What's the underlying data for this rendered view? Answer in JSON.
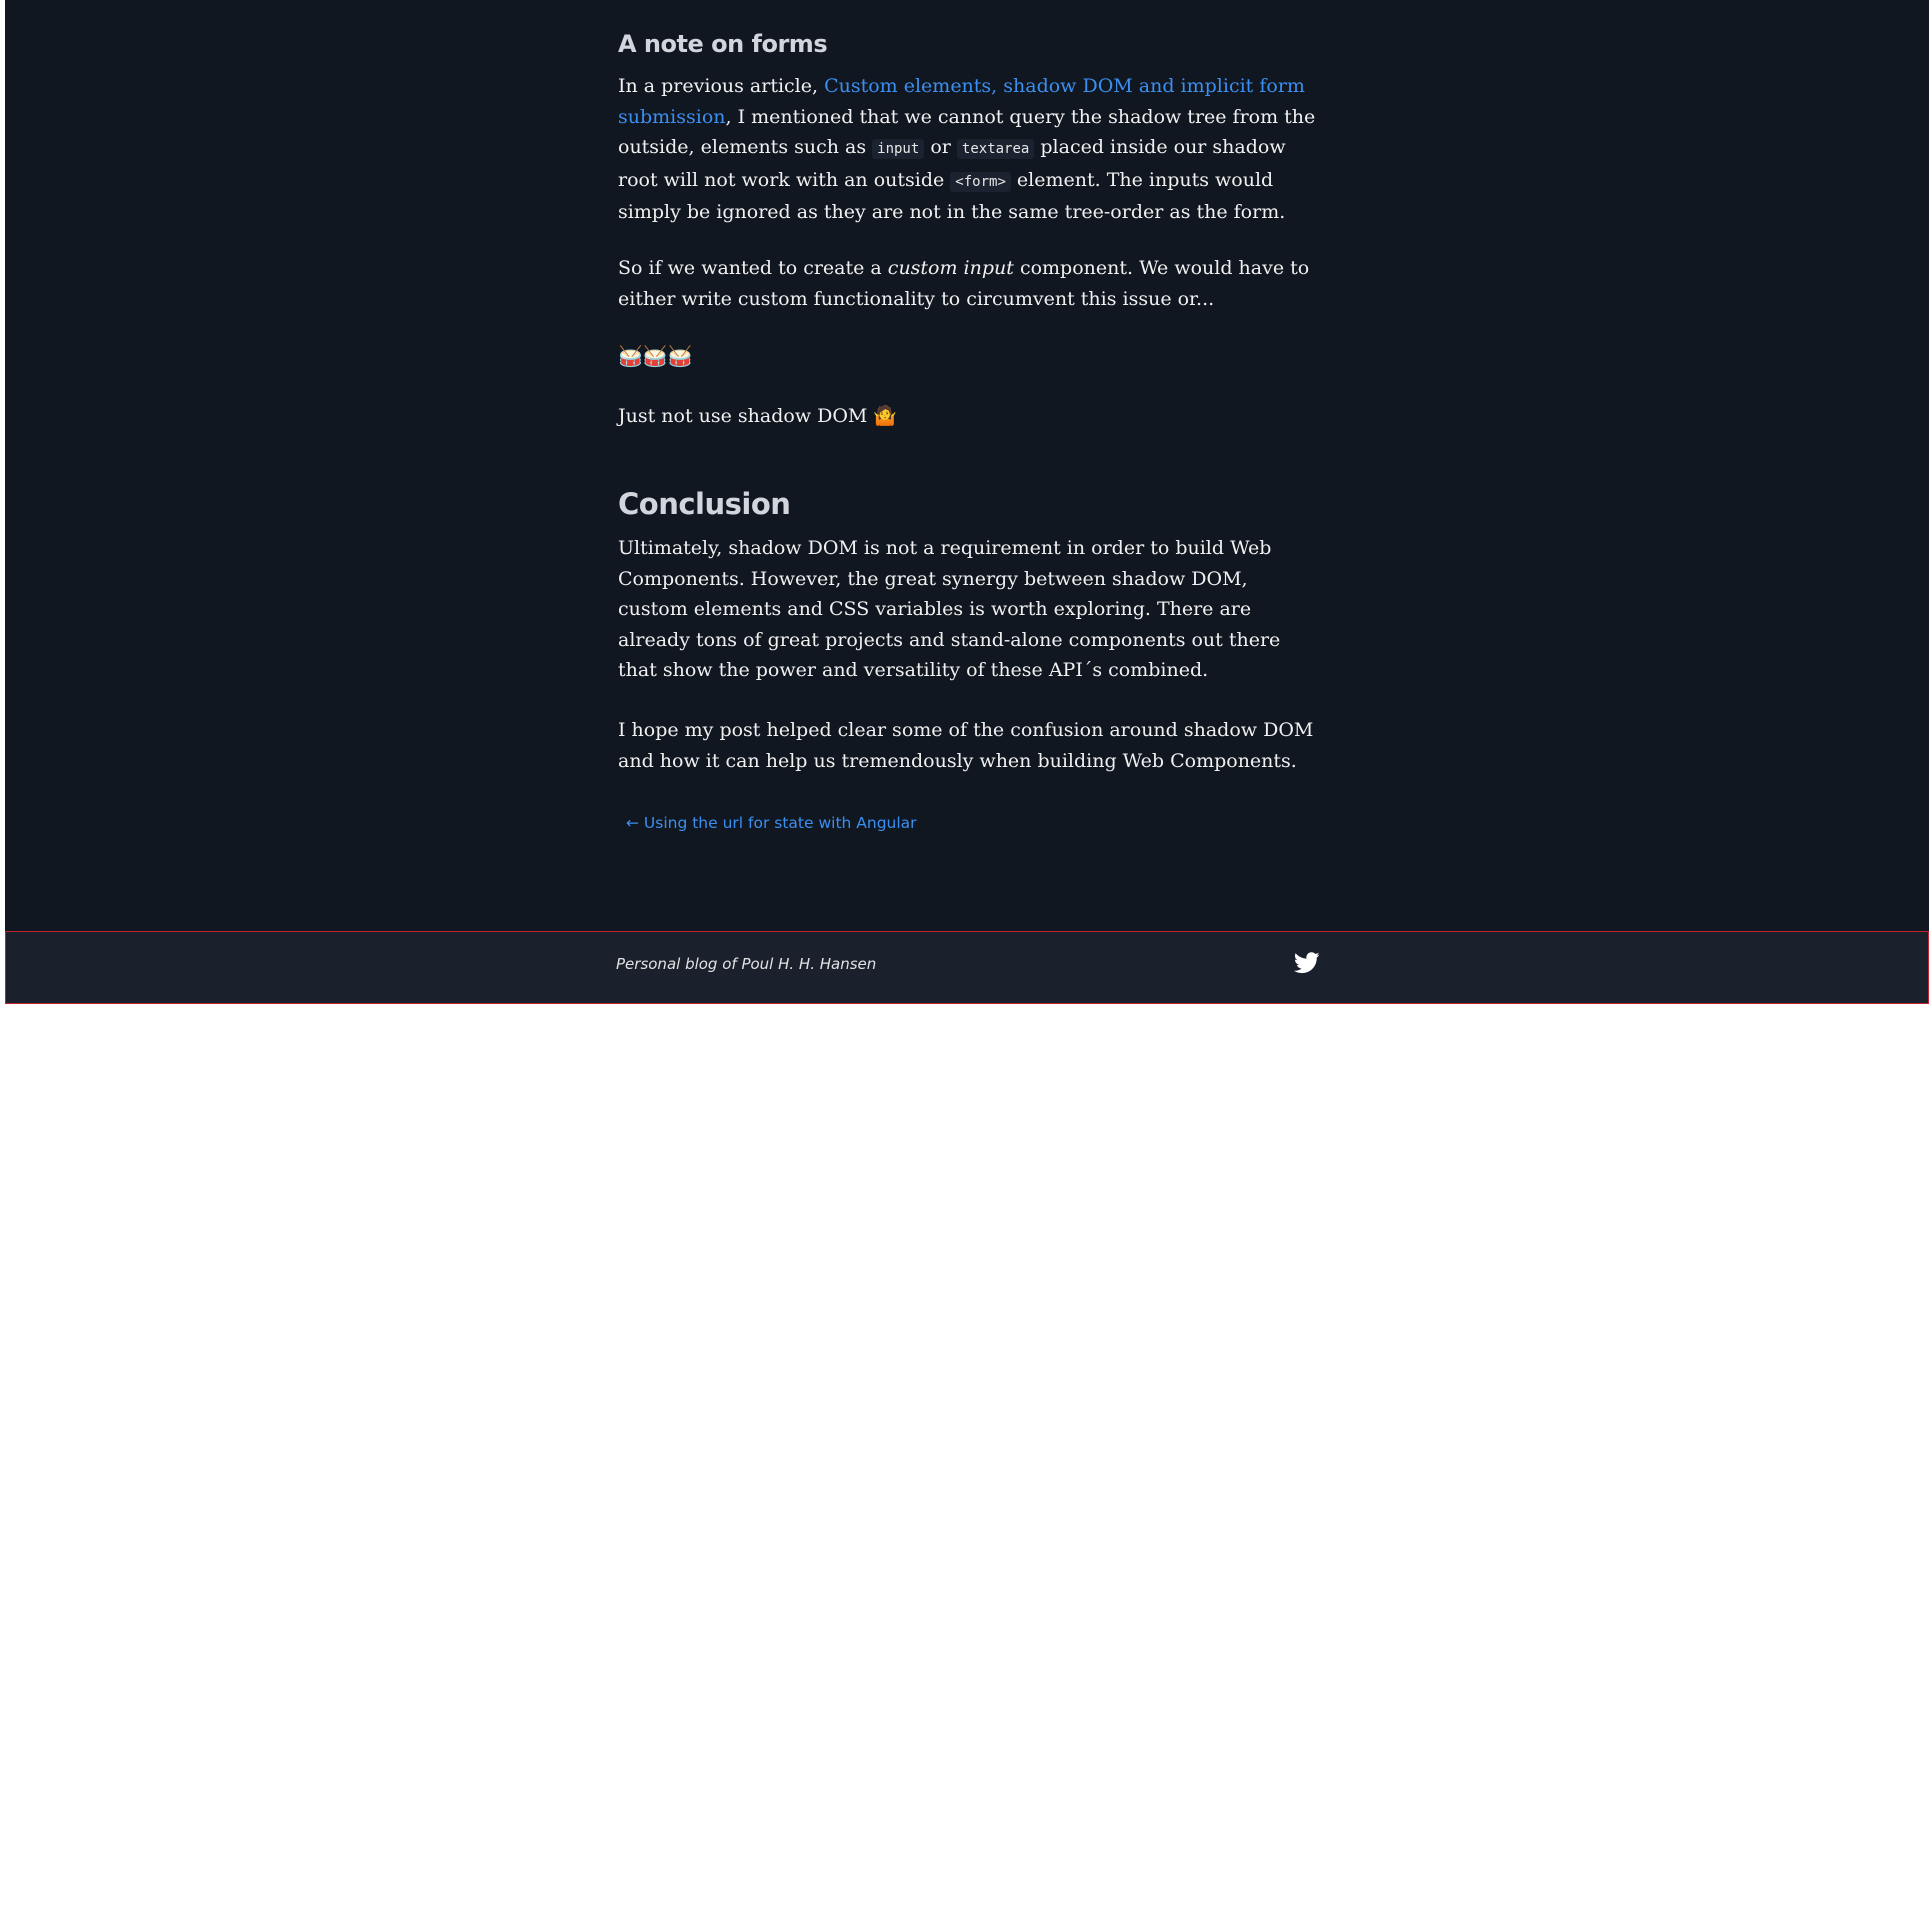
{
  "section_forms": {
    "heading": "A note on forms",
    "p1": {
      "before": "In a previous article, ",
      "link": "Custom elements, shadow DOM and implicit form submission",
      "mid1": ", I mentioned that we cannot query the shadow tree from the outside, elements such as ",
      "code1": "input",
      "mid2": " or ",
      "code2": "textarea",
      "mid3": " placed inside our shadow root will not work with an outside ",
      "code3": "<form>",
      "after": " element. The inputs would simply be ignored as they are not in the same tree-order as the form."
    },
    "p2": {
      "before": "So if we wanted to create a ",
      "em": "custom input",
      "after": " component. We would have to either write custom functionality to circumvent this issue or..."
    },
    "drums": "🥁🥁🥁",
    "p4": "Just not use shadow DOM 🤷"
  },
  "section_conclusion": {
    "heading": "Conclusion",
    "p1": "Ultimately, shadow DOM is not a requirement in order to build Web Components. However, the great synergy between shadow DOM, custom elements and CSS variables is worth exploring. There are already tons of great projects and stand-alone components out there that show the power and versatility of these API´s combined.",
    "p2": "I hope my post helped clear some of the confusion around shadow DOM and how it can help us tremendously when building Web Components."
  },
  "nav": {
    "prev": "← Using the url for state with Angular"
  },
  "footer": {
    "text": "Personal blog of Poul H. H. Hansen",
    "icon": "twitter-icon"
  },
  "colors": {
    "background": "#111720",
    "footer_background": "#1a202c",
    "link": "#3b8ff0",
    "footer_border": "#c0232e"
  }
}
